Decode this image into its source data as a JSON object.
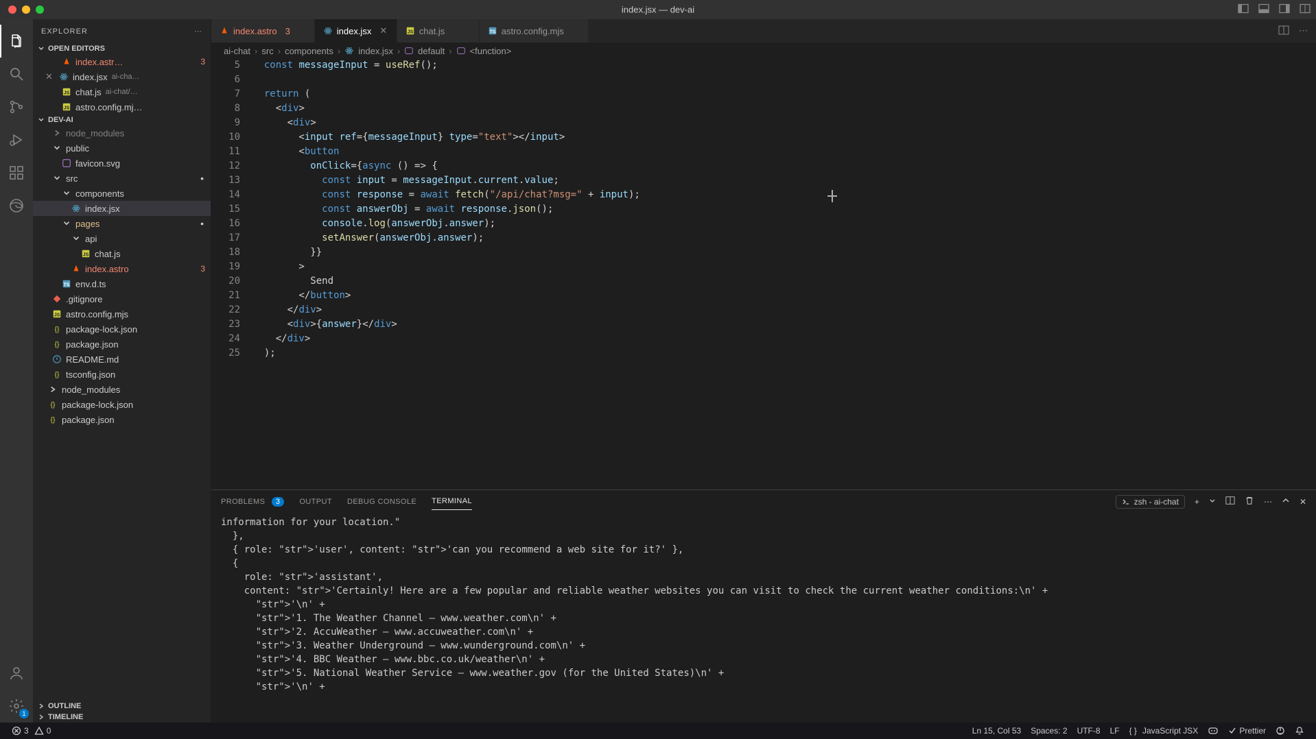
{
  "window": {
    "title": "index.jsx — dev-ai"
  },
  "sidebar": {
    "title": "EXPLORER",
    "sections": {
      "open_editors": "OPEN EDITORS",
      "project": "DEV-AI",
      "outline": "OUTLINE",
      "timeline": "TIMELINE"
    },
    "openEditors": [
      {
        "name": "index.astr…",
        "icon": "astro",
        "badge": "3"
      },
      {
        "name": "index.jsx",
        "sub": "ai-cha…",
        "icon": "react",
        "close": true
      },
      {
        "name": "chat.js",
        "sub": "ai-chat/…",
        "icon": "js"
      },
      {
        "name": "astro.config.mj…",
        "icon": "js"
      }
    ],
    "tree": [
      {
        "name": "node_modules",
        "kind": "folder",
        "indent": 1,
        "faded": true
      },
      {
        "name": "public",
        "kind": "folder",
        "indent": 1,
        "open": true
      },
      {
        "name": "favicon.svg",
        "kind": "svg",
        "indent": 2
      },
      {
        "name": "src",
        "kind": "folder",
        "indent": 1,
        "open": true,
        "marker": true
      },
      {
        "name": "components",
        "kind": "folder",
        "indent": 2,
        "open": true
      },
      {
        "name": "index.jsx",
        "kind": "react",
        "indent": 3,
        "selected": true
      },
      {
        "name": "pages",
        "kind": "folder",
        "indent": 2,
        "open": true,
        "warn": true,
        "marker": true
      },
      {
        "name": "api",
        "kind": "folder",
        "indent": 3,
        "open": true
      },
      {
        "name": "chat.js",
        "kind": "js",
        "indent": 4
      },
      {
        "name": "index.astro",
        "kind": "astro",
        "indent": 3,
        "err": true,
        "badge": "3"
      },
      {
        "name": "env.d.ts",
        "kind": "ts",
        "indent": 2
      },
      {
        "name": ".gitignore",
        "kind": "git",
        "indent": 1
      },
      {
        "name": "astro.config.mjs",
        "kind": "js",
        "indent": 1
      },
      {
        "name": "package-lock.json",
        "kind": "json",
        "indent": 1
      },
      {
        "name": "package.json",
        "kind": "json",
        "indent": 1
      },
      {
        "name": "README.md",
        "kind": "readme",
        "indent": 1
      },
      {
        "name": "tsconfig.json",
        "kind": "json",
        "indent": 1
      },
      {
        "name": "node_modules",
        "kind": "folder",
        "indent": 0
      },
      {
        "name": "package-lock.json",
        "kind": "json",
        "indent": 0
      },
      {
        "name": "package.json",
        "kind": "json",
        "indent": 0
      }
    ]
  },
  "tabs": [
    {
      "label": "index.astro",
      "icon": "astro",
      "badge": "3"
    },
    {
      "label": "index.jsx",
      "icon": "react",
      "active": true
    },
    {
      "label": "chat.js",
      "icon": "js"
    },
    {
      "label": "astro.config.mjs",
      "icon": "ts"
    }
  ],
  "breadcrumb": [
    "ai-chat",
    "src",
    "components",
    "index.jsx",
    "default",
    "<function>"
  ],
  "code": {
    "start": 5,
    "lines": [
      "  const messageInput = useRef();",
      "",
      "  return (",
      "    <div>",
      "      <div>",
      "        <input ref={messageInput} type=\"text\"></input>",
      "        <button",
      "          onClick={async () => {",
      "            const input = messageInput.current.value;",
      "            const response = await fetch(\"/api/chat?msg=\" + input);",
      "            const answerObj = await response.json();",
      "            console.log(answerObj.answer);",
      "            setAnswer(answerObj.answer);",
      "          }}",
      "        >",
      "          Send",
      "        </button>",
      "      </div>",
      "      <div>{answer}</div>",
      "    </div>",
      "  );"
    ]
  },
  "panel": {
    "tabs": {
      "problems": "PROBLEMS",
      "problemsBadge": "3",
      "output": "OUTPUT",
      "debug": "DEBUG CONSOLE",
      "terminal": "TERMINAL"
    },
    "termLabel": "zsh - ai-chat",
    "lines": [
      "information for your location.\"",
      "  },",
      "  { role: 'user', content: 'can you recommend a web site for it?' },",
      "  {",
      "    role: 'assistant',",
      "    content: 'Certainly! Here are a few popular and reliable weather websites you can visit to check the current weather conditions:\\n' +",
      "      '\\n' +",
      "      '1. The Weather Channel – www.weather.com\\n' +",
      "      '2. AccuWeather – www.accuweather.com\\n' +",
      "      '3. Weather Underground – www.wunderground.com\\n' +",
      "      '4. BBC Weather – www.bbc.co.uk/weather\\n' +",
      "      '5. National Weather Service – www.weather.gov (for the United States)\\n' +",
      "      '\\n' +"
    ]
  },
  "status": {
    "errors": "3",
    "warnings": "0",
    "position": "Ln 15, Col 53",
    "spaces": "Spaces: 2",
    "encoding": "UTF-8",
    "eol": "LF",
    "lang": "JavaScript JSX",
    "prettier": "Prettier"
  },
  "activity": {
    "settingsBadge": "1"
  }
}
